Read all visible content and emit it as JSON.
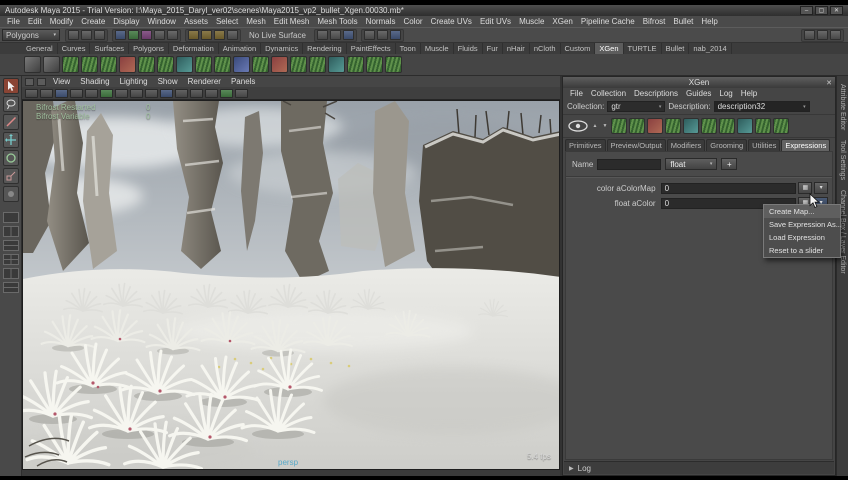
{
  "window": {
    "title": "Autodesk Maya 2015 - Trial Version: I:\\Maya_2015_Daryl_ver02\\scenes\\Maya2015_vp2_bullet_Xgen.00030.mb*",
    "minimize": "–",
    "maximize": "▢",
    "close": "✕"
  },
  "menu_bar": {
    "items": [
      "File",
      "Edit",
      "Modify",
      "Create",
      "Display",
      "Window",
      "Assets",
      "Select",
      "Mesh",
      "Edit Mesh",
      "Mesh Tools",
      "Normals",
      "Color",
      "Create UVs",
      "Edit UVs",
      "Muscle",
      "XGen",
      "Pipeline Cache",
      "Bifrost",
      "Bullet",
      "Help"
    ]
  },
  "status_line": {
    "mode": "Polygons",
    "live_surface": "No Live Surface"
  },
  "shelf": {
    "tabs": [
      "General",
      "Curves",
      "Surfaces",
      "Polygons",
      "Deformation",
      "Animation",
      "Dynamics",
      "Rendering",
      "PaintEffects",
      "Toon",
      "Muscle",
      "Fluids",
      "Fur",
      "nHair",
      "nCloth",
      "Custom",
      "XGen",
      "TURTLE",
      "Bullet",
      "nab_2014"
    ]
  },
  "panel": {
    "menus": [
      "View",
      "Shading",
      "Lighting",
      "Show",
      "Renderer",
      "Panels"
    ]
  },
  "viewport": {
    "hud": {
      "line1_label": "Bifrost Restarted",
      "line1_value": "0",
      "line2_label": "Bifrost Variable",
      "line2_value": "0"
    },
    "fps": "5.4 fps",
    "camera": "persp"
  },
  "xgen": {
    "title": "XGen",
    "menus": [
      "File",
      "Collection",
      "Descriptions",
      "Guides",
      "Log",
      "Help"
    ],
    "collection_label": "Collection:",
    "collection_value": "gtr",
    "description_label": "Description:",
    "description_value": "description32",
    "tabs": [
      "Primitives",
      "Preview/Output",
      "Modifiers",
      "Grooming",
      "Utilities",
      "Expressions"
    ],
    "name_label": "Name",
    "type_value": "float",
    "add_button": "+",
    "attr1_label": "color aColorMap",
    "attr1_value": "0",
    "attr2_label": "float aColor",
    "attr2_value": "0",
    "context_menu": [
      "Create Map...",
      "Save Expression As...",
      "Load Expression",
      "Reset to a slider"
    ],
    "log_label": "Log"
  },
  "right_tabs": [
    "Attribute Editor",
    "Tool Settings",
    "Channel Box / Layer Editor"
  ]
}
